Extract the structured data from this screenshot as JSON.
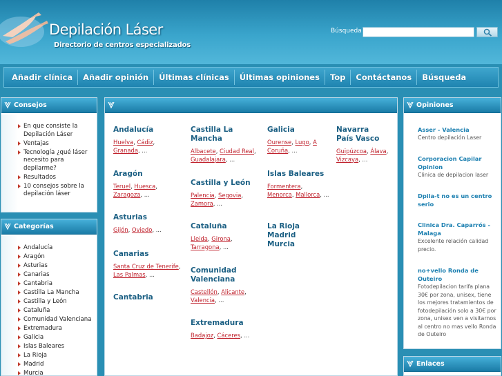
{
  "header": {
    "title": "Depilación Láser",
    "subtitle": "Directorio de centros especializados",
    "search_label": "Búsqueda",
    "search_value": ""
  },
  "nav": [
    "Añadir clínica",
    "Añadir opinión",
    "Últimas clínicas",
    "Últimas opiniones",
    "Top",
    "Contáctanos",
    "Búsqueda"
  ],
  "consejos": {
    "title": "Consejos",
    "items": [
      "En que consiste la Depilación Láser",
      "Ventajas",
      "Tecnología ¿qué láser necesito para depilarme?",
      "Resultados",
      "10 consejos sobre la depilación láser"
    ]
  },
  "categorias": {
    "title": "Categorías",
    "items": [
      "Andalucía",
      "Aragón",
      "Asturias",
      "Canarias",
      "Cantabria",
      "Castilla La Mancha",
      "Castilla y León",
      "Cataluña",
      "Comunidad Valenciana",
      "Extremadura",
      "Galicia",
      "Islas Baleares",
      "La Rioja",
      "Madrid",
      "Murcia"
    ]
  },
  "regions": {
    "andalucia": {
      "name": "Andalucía",
      "cities": [
        "Huelva",
        "Cádiz",
        "Granada"
      ],
      "more": "..."
    },
    "aragon": {
      "name": "Aragón",
      "cities": [
        "Teruel",
        "Huesca",
        "Zaragoza"
      ],
      "more": "..."
    },
    "asturias": {
      "name": "Asturias",
      "cities": [
        "Gijón",
        "Oviedo"
      ],
      "more": "..."
    },
    "canarias": {
      "name": "Canarias",
      "cities": [
        "Santa Cruz de Tenerife",
        "Las Palmas"
      ],
      "more": "..."
    },
    "cantabria": {
      "name": "Cantabria"
    },
    "castilla_mancha": {
      "name": "Castilla La Mancha",
      "cities": [
        "Albacete",
        "Ciudad Real",
        "Guadalajara"
      ],
      "more": "..."
    },
    "castilla_leon": {
      "name": "Castilla y León",
      "cities": [
        "Palencia",
        "Segovia",
        "Zamora"
      ],
      "more": "..."
    },
    "cataluna": {
      "name": "Cataluña",
      "cities": [
        "Lleida",
        "Girona",
        "Tarragona"
      ],
      "more": "..."
    },
    "valenciana": {
      "name": "Comunidad Valenciana",
      "cities": [
        "Castellón",
        "Alicante",
        "Valencia"
      ],
      "more": "..."
    },
    "extremadura": {
      "name": "Extremadura",
      "cities": [
        "Badajoz",
        "Cáceres"
      ],
      "more": "..."
    },
    "galicia": {
      "name": "Galicia",
      "cities": [
        "Ourense",
        "Lugo",
        "A Coruña"
      ],
      "more": "..."
    },
    "baleares": {
      "name": "Islas Baleares",
      "cities": [
        "Formentera",
        "Menorca",
        "Mallorca"
      ],
      "more": "..."
    },
    "rioja": {
      "name": "La Rioja"
    },
    "madrid": {
      "name": "Madrid"
    },
    "murcia": {
      "name": "Murcia"
    },
    "navarra": {
      "name": "Navarra"
    },
    "pais_vasco": {
      "name": "País Vasco",
      "cities": [
        "Guipúzcoa",
        "Álava",
        "Vizcaya"
      ],
      "more": "..."
    }
  },
  "opiniones": {
    "title": "Opiniones",
    "items": [
      {
        "title": "Asser - Valencia",
        "text": "Centro depilación Laser"
      },
      {
        "title": "Corporacion Capilar Opinion",
        "text": "Clinica de depilacion laser"
      },
      {
        "title": "Dpila-t no es un centro serio",
        "text": ""
      },
      {
        "title": "Clinica Dra. Caparrós - Malaga",
        "text": "Excelente relación calidad precio."
      },
      {
        "title": "no+vello Ronda de Outeiro",
        "text": "Fotodepilacion tarifa plana 30€ por zona, unisex, tiene los mejores tratamientos de fotodepilación solo a 30€ por zona, unisex ven a visitarnos al centro no mas vello Ronda de Outeiro"
      }
    ]
  },
  "enlaces": {
    "title": "Enlaces"
  },
  "colors": {
    "accent": "#1b7fb0",
    "link": "#c0222d",
    "header": "#2a8fb4"
  }
}
